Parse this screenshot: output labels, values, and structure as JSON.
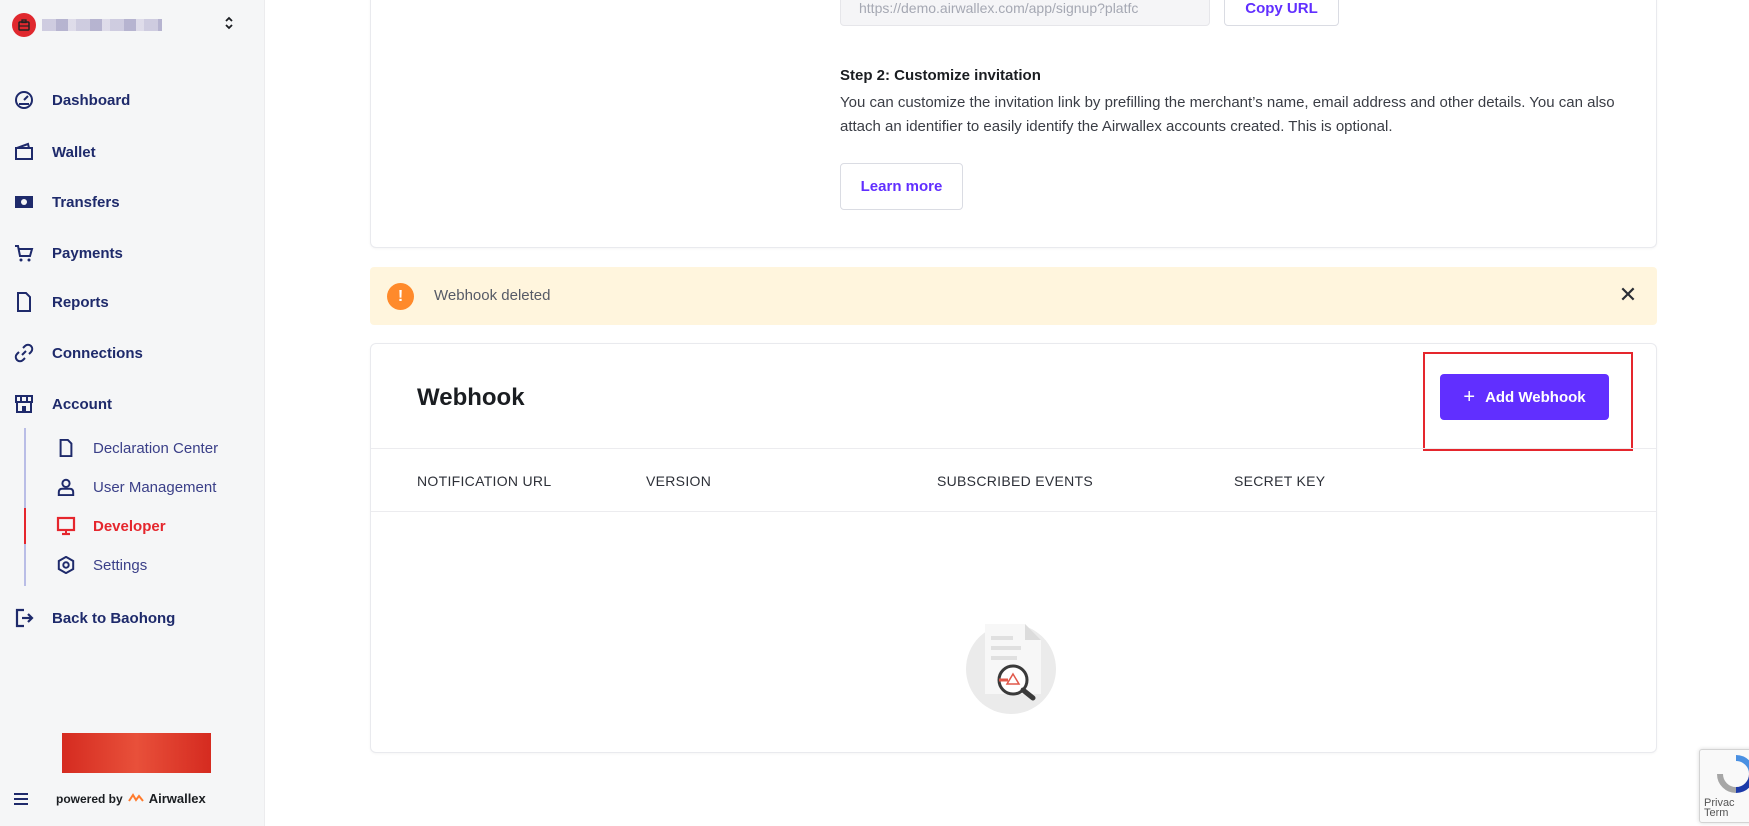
{
  "sidebar": {
    "nav": [
      {
        "label": "Dashboard",
        "icon": "dashboard-icon"
      },
      {
        "label": "Wallet",
        "icon": "wallet-icon"
      },
      {
        "label": "Transfers",
        "icon": "transfers-icon"
      },
      {
        "label": "Payments",
        "icon": "cart-icon"
      },
      {
        "label": "Reports",
        "icon": "document-icon"
      },
      {
        "label": "Connections",
        "icon": "link-icon"
      },
      {
        "label": "Account",
        "icon": "store-icon"
      }
    ],
    "account_sub": [
      {
        "label": "Declaration Center",
        "icon": "document-icon",
        "active": false
      },
      {
        "label": "User Management",
        "icon": "user-icon",
        "active": false
      },
      {
        "label": "Developer",
        "icon": "monitor-icon",
        "active": true
      },
      {
        "label": "Settings",
        "icon": "gear-icon",
        "active": false
      }
    ],
    "back_label": "Back to Baohong",
    "powered_by": "powered by",
    "powered_brand": "Airwallex",
    "accent_active": "#e5262d",
    "nav_color": "#1e2a6b"
  },
  "invite": {
    "url_value": "https://demo.airwallex.com/app/signup?platfc",
    "copy_label": "Copy URL",
    "step2_title": "Step 2: Customize invitation",
    "step2_desc": "You can customize the invitation link by prefilling the merchant’s name, email address and other details. You can also attach an identifier to easily identify the Airwallex accounts created. This is optional.",
    "learn_more_label": "Learn more"
  },
  "alert": {
    "text": "Webhook deleted",
    "icon_glyph": "!",
    "close_glyph": "✕",
    "color": "#fff5dd"
  },
  "webhook": {
    "title": "Webhook",
    "add_label": "Add Webhook",
    "add_plus": "+",
    "columns": [
      "NOTIFICATION URL",
      "VERSION",
      "SUBSCRIBED EVENTS",
      "SECRET KEY"
    ],
    "accent": "#612fff"
  },
  "recaptcha": {
    "text_line1": "Privac",
    "text_line2": "Term"
  }
}
